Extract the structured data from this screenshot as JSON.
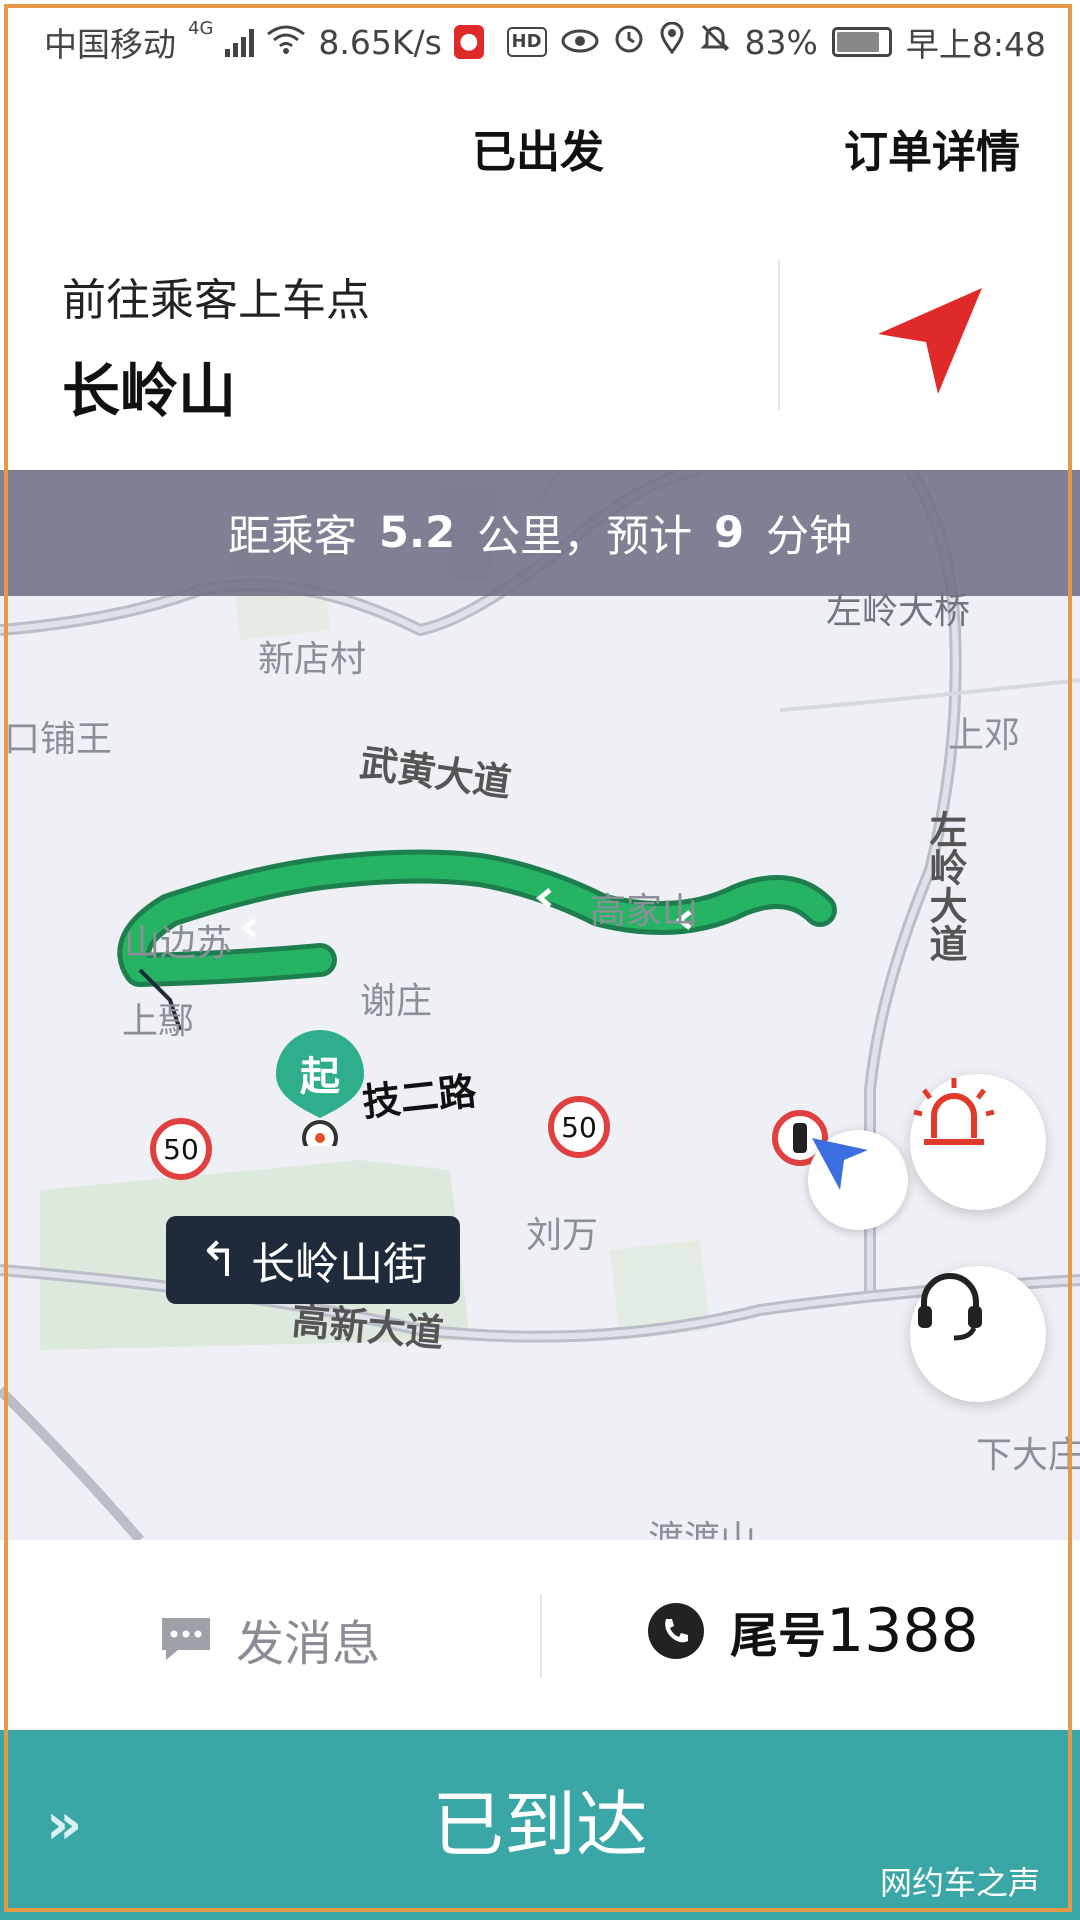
{
  "status_bar": {
    "carrier": "中国移动",
    "network": "4G",
    "speed": "8.65K/s",
    "battery": "83%",
    "time": "早上8:48"
  },
  "header": {
    "status": "已出发",
    "order_detail": "订单详情"
  },
  "destination": {
    "label": "前往乘客上车点",
    "name": "长岭山"
  },
  "distance_bar": {
    "prefix": "距乘客",
    "distance": "5.2",
    "unit": "公里，预计",
    "minutes": "9",
    "minutes_unit": "分钟"
  },
  "map": {
    "places": [
      "新店村",
      "口铺王",
      "高家山",
      "山边苏",
      "上鄢",
      "谢庄",
      "刘万",
      "上邓",
      "下大庄",
      "渡渡山",
      "左岭大桥"
    ],
    "roads": [
      "武黄大道",
      "技二路",
      "高新大道",
      "左岭大道"
    ],
    "start_label": "起",
    "speed_limit": "50",
    "speed_limit_2": "50",
    "turn_instruction": "长岭山街"
  },
  "bottom": {
    "message": "发消息",
    "phone_prefix": "尾号",
    "phone_tail": "1388"
  },
  "arrive_button": {
    "label": "已到达",
    "watermark": "网约车之声"
  },
  "colors": {
    "accent": "#3ba6a6",
    "route": "#22a862",
    "nav_arrow": "#e02a2a",
    "dist_bar": "#6e7185"
  }
}
